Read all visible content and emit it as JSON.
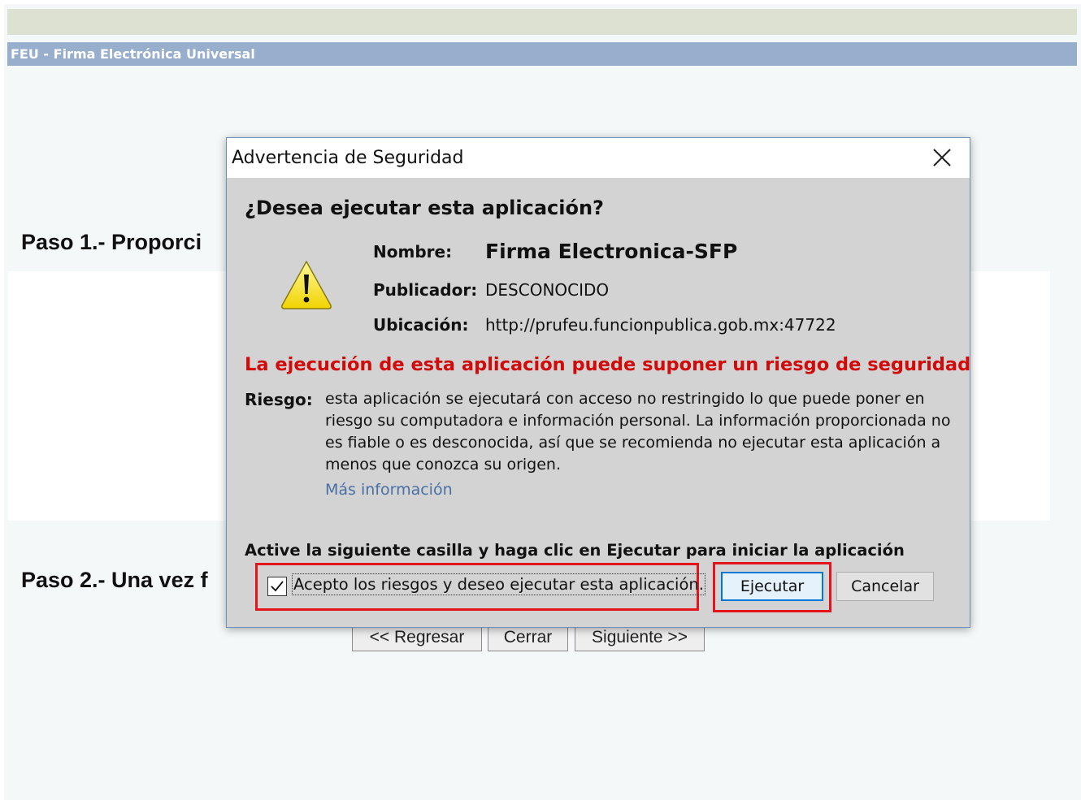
{
  "page": {
    "app_title": "FEU - Firma Electrónica Universal",
    "step1_heading": "Paso 1.- Proporci",
    "step2_heading": "Paso 2.- Una vez f",
    "nav": {
      "back_label": "<< Regresar",
      "close_label": "Cerrar",
      "next_label": "Siguiente >>"
    }
  },
  "dialog": {
    "title": "Advertencia de Seguridad",
    "question": "¿Desea ejecutar esta aplicación?",
    "fields": [
      {
        "label": "Nombre:",
        "value": "Firma Electronica-SFP"
      },
      {
        "label": "Publicador:",
        "value": "DESCONOCIDO"
      },
      {
        "label": "Ubicación:",
        "value": "http://prufeu.funcionpublica.gob.mx:47722"
      }
    ],
    "risk_title": "La ejecución de esta aplicación puede suponer un riesgo de seguridad",
    "risk_label": "Riesgo:",
    "risk_text": "esta aplicación se ejecutará con acceso no restringido lo que puede poner en riesgo su computadora e información personal. La información proporcionada no es fiable o es desconocida, así que se recomienda no ejecutar esta aplicación a menos que conozca su origen.",
    "more_info": "Más información",
    "instruction": "Active la siguiente casilla y haga clic en Ejecutar para iniciar la aplicación",
    "checkbox_label": "Acepto los riesgos y deseo ejecutar esta aplicación.",
    "checkbox_checked": true,
    "run_label": "Ejecutar",
    "cancel_label": "Cancelar"
  },
  "colors": {
    "title_bar": "#97aecd",
    "risk_red": "#d10a0a",
    "highlight_red": "#e3141c",
    "link_blue": "#4a6fa5",
    "dialog_bg": "#d3d3d3"
  },
  "icons": {
    "warning": "warning-triangle-icon",
    "close": "close-icon",
    "check": "check-icon"
  }
}
